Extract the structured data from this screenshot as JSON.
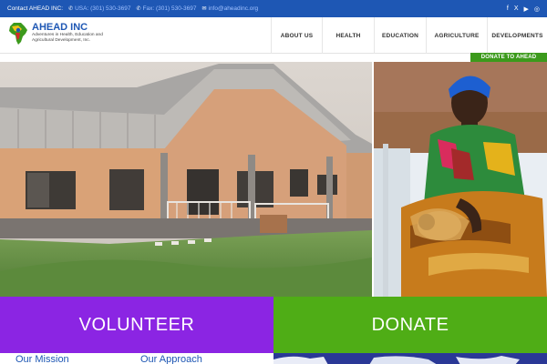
{
  "topbar": {
    "contact_label": "Contact AHEAD INC:",
    "usa_label": "USA: (301) 530-3697",
    "fax_label": "Fax: (301) 530-3697",
    "email_label": "info@aheadinc.org",
    "phone_icon": "phone-icon",
    "email_icon": "envelope-icon",
    "social": [
      "facebook-icon",
      "x-icon",
      "youtube-icon",
      "instagram-icon"
    ],
    "social_glyphs": [
      "f",
      "X",
      "▶",
      "◎"
    ]
  },
  "header": {
    "logo_name": "AHEAD INC",
    "logo_tagline": "Adventures in Health, Education and Agricultural Development, Inc."
  },
  "nav": {
    "items": [
      "ABOUT US",
      "HEALTH",
      "EDUCATION",
      "AGRICULTURE",
      "DEVELOPMENTS"
    ]
  },
  "ribbon": {
    "label": "DONATE TO AHEAD"
  },
  "cta": {
    "volunteer": "VOLUNTEER",
    "donate": "DONATE"
  },
  "bottom": {
    "mission": "Our Mission",
    "approach": "Our Approach"
  },
  "colors": {
    "brand_blue": "#1e57b4",
    "volunteer_purple": "#8b25e3",
    "donate_green": "#4fad16",
    "ribbon_green": "#3c9a1c"
  }
}
